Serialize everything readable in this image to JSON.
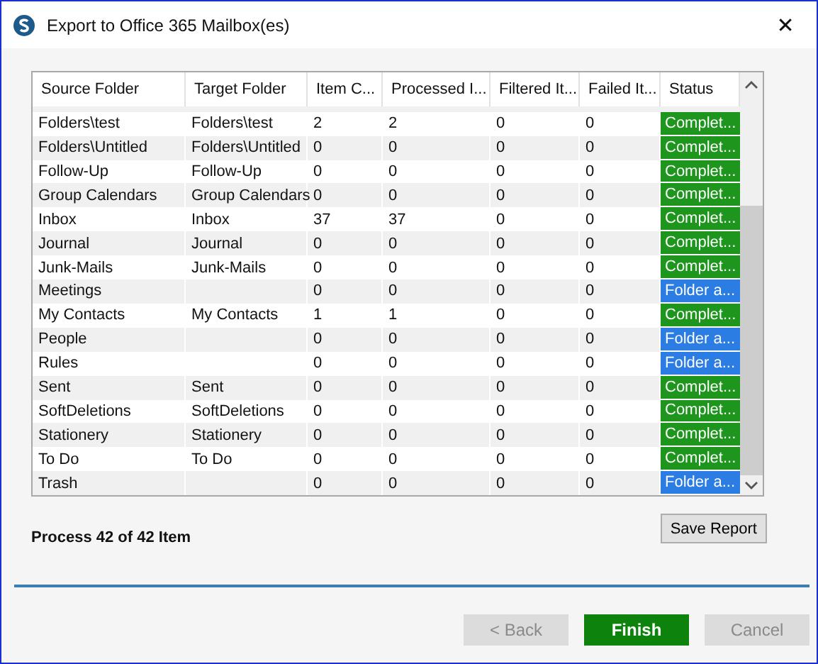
{
  "window": {
    "title": "Export to Office 365 Mailbox(es)",
    "close": "✕"
  },
  "table": {
    "columns": [
      "Source Folder",
      "Target Folder",
      "Item C...",
      "Processed I...",
      "Filtered It...",
      "Failed It...",
      "Status"
    ],
    "rows": [
      {
        "cells": [
          "Folders\\test",
          "Folders\\test",
          "2",
          "2",
          "0",
          "0"
        ],
        "status": "Complet...",
        "kind": "completed"
      },
      {
        "cells": [
          "Folders\\Untitled",
          "Folders\\Untitled",
          "0",
          "0",
          "0",
          "0"
        ],
        "status": "Complet...",
        "kind": "completed"
      },
      {
        "cells": [
          "Follow-Up",
          "Follow-Up",
          "0",
          "0",
          "0",
          "0"
        ],
        "status": "Complet...",
        "kind": "completed"
      },
      {
        "cells": [
          "Group Calendars",
          "Group Calendars",
          "0",
          "0",
          "0",
          "0"
        ],
        "status": "Complet...",
        "kind": "completed"
      },
      {
        "cells": [
          "Inbox",
          "Inbox",
          "37",
          "37",
          "0",
          "0"
        ],
        "status": "Complet...",
        "kind": "completed"
      },
      {
        "cells": [
          "Journal",
          "Journal",
          "0",
          "0",
          "0",
          "0"
        ],
        "status": "Complet...",
        "kind": "completed"
      },
      {
        "cells": [
          "Junk-Mails",
          "Junk-Mails",
          "0",
          "0",
          "0",
          "0"
        ],
        "status": "Complet...",
        "kind": "completed"
      },
      {
        "cells": [
          "Meetings",
          "",
          "0",
          "0",
          "0",
          "0"
        ],
        "status": "Folder a...",
        "kind": "folder"
      },
      {
        "cells": [
          "My Contacts",
          "My Contacts",
          "1",
          "1",
          "0",
          "0"
        ],
        "status": "Complet...",
        "kind": "completed"
      },
      {
        "cells": [
          "People",
          "",
          "0",
          "0",
          "0",
          "0"
        ],
        "status": "Folder a...",
        "kind": "folder"
      },
      {
        "cells": [
          "Rules",
          "",
          "0",
          "0",
          "0",
          "0"
        ],
        "status": "Folder a...",
        "kind": "folder"
      },
      {
        "cells": [
          "Sent",
          "Sent",
          "0",
          "0",
          "0",
          "0"
        ],
        "status": "Complet...",
        "kind": "completed"
      },
      {
        "cells": [
          "SoftDeletions",
          "SoftDeletions",
          "0",
          "0",
          "0",
          "0"
        ],
        "status": "Complet...",
        "kind": "completed"
      },
      {
        "cells": [
          "Stationery",
          "Stationery",
          "0",
          "0",
          "0",
          "0"
        ],
        "status": "Complet...",
        "kind": "completed"
      },
      {
        "cells": [
          "To Do",
          "To Do",
          "0",
          "0",
          "0",
          "0"
        ],
        "status": "Complet...",
        "kind": "completed"
      },
      {
        "cells": [
          "Trash",
          "",
          "0",
          "0",
          "0",
          "0"
        ],
        "status": "Folder a...",
        "kind": "folder"
      }
    ]
  },
  "progress_text": "Process 42 of 42 Item",
  "save_button": "Save Report",
  "buttons": [
    {
      "label": "< Back",
      "disabled": true,
      "kind": "secondary"
    },
    {
      "label": "Finish",
      "disabled": false,
      "kind": "primary"
    },
    {
      "label": "Cancel",
      "disabled": true,
      "kind": "secondary"
    }
  ]
}
